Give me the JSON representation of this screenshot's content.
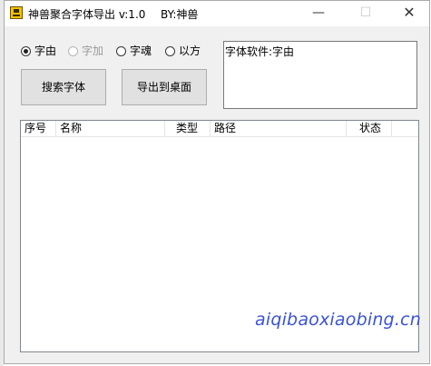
{
  "window": {
    "title": "神兽聚合字体导出 v:1.0",
    "author": "BY:神兽",
    "minimize_glyph": "—",
    "maximize_glyph": "☐",
    "close_glyph": "✕"
  },
  "options": {
    "selected": "字由",
    "items": [
      {
        "label": "字由",
        "checked": true,
        "enabled": true
      },
      {
        "label": "字加",
        "checked": false,
        "enabled": false
      },
      {
        "label": "字魂",
        "checked": false,
        "enabled": true
      },
      {
        "label": "以方",
        "checked": false,
        "enabled": true
      }
    ]
  },
  "buttons": {
    "search": "搜索字体",
    "export": "导出到桌面"
  },
  "info": {
    "text": "字体软件:字由"
  },
  "table": {
    "columns": [
      "序号",
      "名称",
      "类型",
      "路径",
      "状态"
    ],
    "rows": []
  },
  "watermark": "aiqibaoxiaobing.cn",
  "colors": {
    "window_bg": "#f0f0f0",
    "button_bg": "#e1e1e1",
    "watermark": "#3a52d6"
  }
}
